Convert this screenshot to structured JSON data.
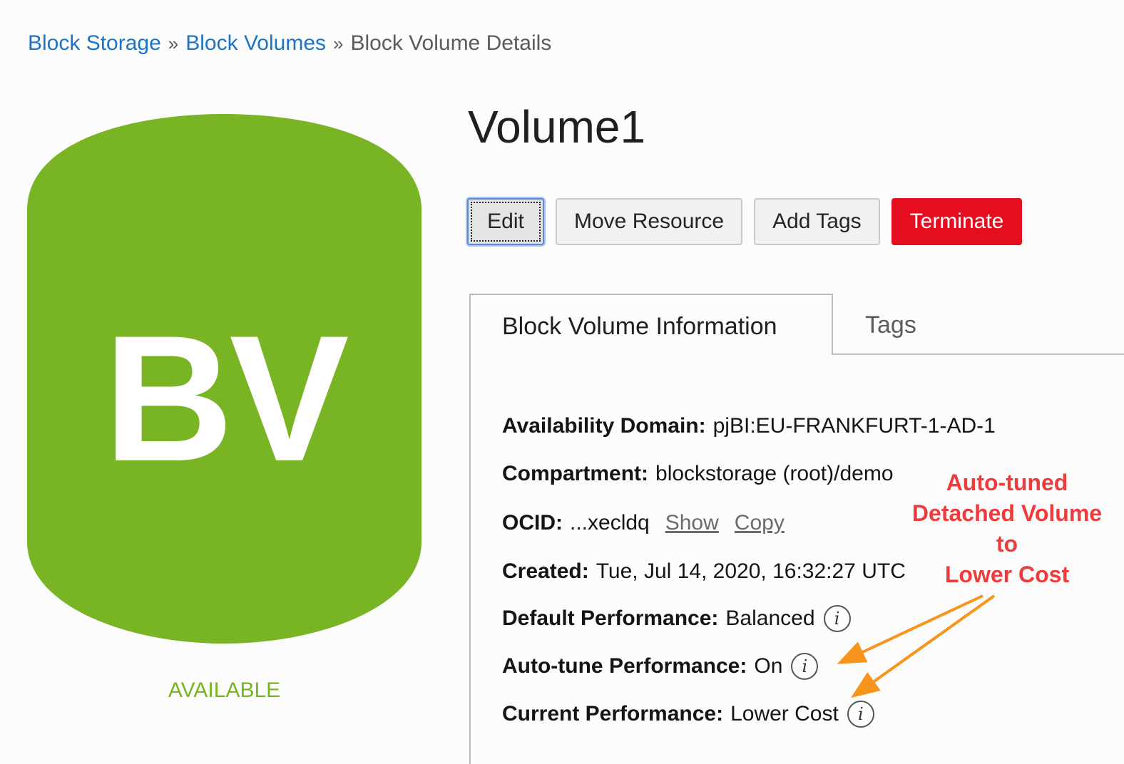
{
  "breadcrumb": {
    "items": [
      "Block Storage",
      "Block Volumes"
    ],
    "current": "Block Volume Details",
    "separator": "»"
  },
  "resource": {
    "abbr": "BV",
    "status": "AVAILABLE",
    "icon_color": "#78b424",
    "status_color": "#78b424"
  },
  "title": "Volume1",
  "actions": {
    "edit": "Edit",
    "move_resource": "Move Resource",
    "add_tags": "Add Tags",
    "terminate": "Terminate",
    "danger_color": "#e40e1f"
  },
  "tabs": [
    {
      "label": "Block Volume Information",
      "active": true
    },
    {
      "label": "Tags",
      "active": false
    }
  ],
  "info": {
    "availability_domain": {
      "label": "Availability Domain:",
      "value": "pjBI:EU-FRANKFURT-1-AD-1"
    },
    "compartment": {
      "label": "Compartment:",
      "value": "blockstorage (root)/demo"
    },
    "ocid": {
      "label": "OCID:",
      "value": "...xecldq",
      "show": "Show",
      "copy": "Copy"
    },
    "created": {
      "label": "Created:",
      "value": "Tue, Jul 14, 2020, 16:32:27 UTC"
    },
    "default_performance": {
      "label": "Default Performance:",
      "value": "Balanced"
    },
    "autotune_performance": {
      "label": "Auto-tune Performance:",
      "value": "On"
    },
    "current_performance": {
      "label": "Current Performance:",
      "value": "Lower Cost"
    },
    "info_icon_glyph": "i"
  },
  "annotation": {
    "lines": [
      "Auto-tuned",
      "Detached Volume",
      "to",
      "Lower Cost"
    ],
    "text_color": "#ef3b3b",
    "arrow_color": "#f7941d"
  }
}
